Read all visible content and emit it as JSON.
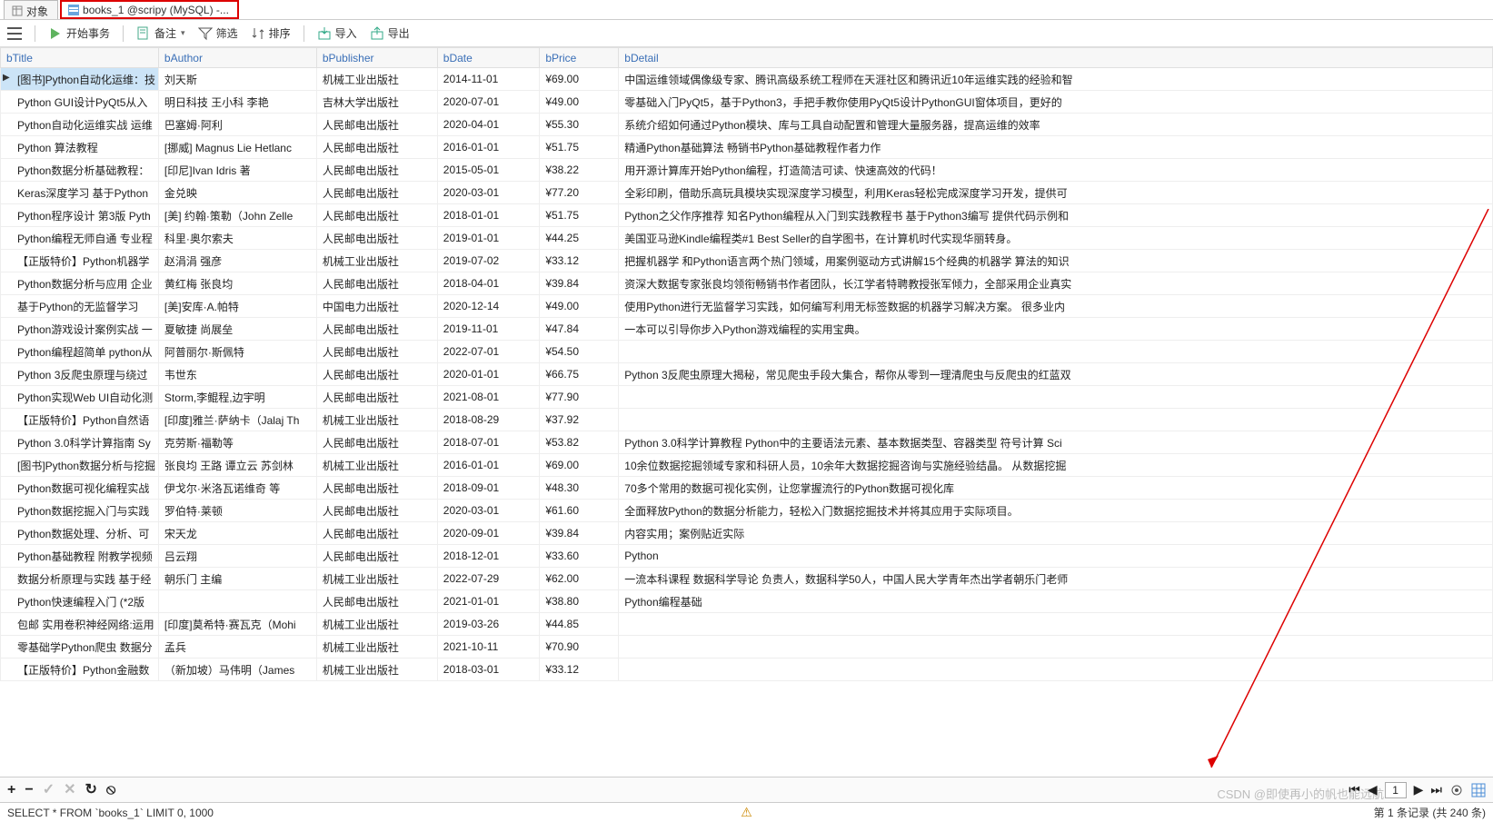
{
  "tabs": {
    "objects": "对象",
    "active": "books_1 @scripy (MySQL) -..."
  },
  "toolbar": {
    "begin_tx": "开始事务",
    "memo": "备注",
    "filter": "筛选",
    "sort": "排序",
    "import": "导入",
    "export": "导出"
  },
  "columns": {
    "bTitle": "bTitle",
    "bAuthor": "bAuthor",
    "bPublisher": "bPublisher",
    "bDate": "bDate",
    "bPrice": "bPrice",
    "bDetail": "bDetail"
  },
  "rows": [
    {
      "bTitle": "[图书]Python自动化运维：技",
      "bAuthor": "刘天斯",
      "bPublisher": "机械工业出版社",
      "bDate": "2014-11-01",
      "bPrice": "¥69.00",
      "bDetail": "中国运维领域偶像级专家、腾讯高级系统工程师在天涯社区和腾讯近10年运维实践的经验和智"
    },
    {
      "bTitle": "Python GUI设计PyQt5从入",
      "bAuthor": "明日科技 王小科 李艳",
      "bPublisher": "吉林大学出版社",
      "bDate": "2020-07-01",
      "bPrice": "¥49.00",
      "bDetail": "零基础入门PyQt5，基于Python3，手把手教你使用PyQt5设计PythonGUI窗体项目，更好的"
    },
    {
      "bTitle": "Python自动化运维实战 运维",
      "bAuthor": "巴塞姆·阿利",
      "bPublisher": "人民邮电出版社",
      "bDate": "2020-04-01",
      "bPrice": "¥55.30",
      "bDetail": "系统介绍如何通过Python模块、库与工具自动配置和管理大量服务器，提高运维的效率"
    },
    {
      "bTitle": "Python 算法教程",
      "bAuthor": "[挪威] Magnus Lie Hetlanc",
      "bPublisher": "人民邮电出版社",
      "bDate": "2016-01-01",
      "bPrice": "¥51.75",
      "bDetail": "精通Python基础算法 畅销书Python基础教程作者力作"
    },
    {
      "bTitle": "Python数据分析基础教程：",
      "bAuthor": "[印尼]Ivan Idris 著",
      "bPublisher": "人民邮电出版社",
      "bDate": "2015-05-01",
      "bPrice": "¥38.22",
      "bDetail": "用开源计算库开始Python编程，打造简洁可读、快速高效的代码！"
    },
    {
      "bTitle": "Keras深度学习 基于Python",
      "bAuthor": "金兑映",
      "bPublisher": "人民邮电出版社",
      "bDate": "2020-03-01",
      "bPrice": "¥77.20",
      "bDetail": "全彩印刷，借助乐高玩具模块实现深度学习模型，利用Keras轻松完成深度学习开发，提供可"
    },
    {
      "bTitle": "Python程序设计 第3版 Pyth",
      "bAuthor": "[美] 约翰·策勒（John Zelle",
      "bPublisher": "人民邮电出版社",
      "bDate": "2018-01-01",
      "bPrice": "¥51.75",
      "bDetail": "Python之父作序推荐 知名Python编程从入门到实践教程书 基于Python3编写 提供代码示例和"
    },
    {
      "bTitle": "Python编程无师自通 专业程",
      "bAuthor": "科里·奥尔索夫",
      "bPublisher": "人民邮电出版社",
      "bDate": "2019-01-01",
      "bPrice": "¥44.25",
      "bDetail": "美国亚马逊Kindle编程类#1 Best Seller的自学图书，在计算机时代实现华丽转身。"
    },
    {
      "bTitle": "【正版特价】Python机器学",
      "bAuthor": "赵涓涓 强彦",
      "bPublisher": "机械工业出版社",
      "bDate": "2019-07-02",
      "bPrice": "¥33.12",
      "bDetail": "把握机器学 和Python语言两个热门领域，用案例驱动方式讲解15个经典的机器学 算法的知识"
    },
    {
      "bTitle": "Python数据分析与应用 企业",
      "bAuthor": "黄红梅 张良均",
      "bPublisher": "人民邮电出版社",
      "bDate": "2018-04-01",
      "bPrice": "¥39.84",
      "bDetail": "资深大数据专家张良均领衔畅销书作者团队，长江学者特聘教授张军倾力，全部采用企业真实"
    },
    {
      "bTitle": "基于Python的无监督学习",
      "bAuthor": "[美]安库·A.帕特",
      "bPublisher": "中国电力出版社",
      "bDate": "2020-12-14",
      "bPrice": "¥49.00",
      "bDetail": "使用Python进行无监督学习实践，如何编写利用无标签数据的机器学习解决方案。 很多业内"
    },
    {
      "bTitle": "Python游戏设计案例实战 一",
      "bAuthor": "夏敏捷 尚展垒",
      "bPublisher": "人民邮电出版社",
      "bDate": "2019-11-01",
      "bPrice": "¥47.84",
      "bDetail": "一本可以引导你步入Python游戏编程的实用宝典。"
    },
    {
      "bTitle": "Python编程超简单 python从",
      "bAuthor": "阿普丽尔·斯佩特",
      "bPublisher": "人民邮电出版社",
      "bDate": "2022-07-01",
      "bPrice": "¥54.50",
      "bDetail": ""
    },
    {
      "bTitle": "Python 3反爬虫原理与绕过",
      "bAuthor": "韦世东",
      "bPublisher": "人民邮电出版社",
      "bDate": "2020-01-01",
      "bPrice": "¥66.75",
      "bDetail": "Python 3反爬虫原理大揭秘，常见爬虫手段大集合，帮你从零到一理清爬虫与反爬虫的红蓝双"
    },
    {
      "bTitle": "Python实现Web UI自动化测",
      "bAuthor": "Storm,李鲲程,边宇明",
      "bPublisher": "人民邮电出版社",
      "bDate": "2021-08-01",
      "bPrice": "¥77.90",
      "bDetail": ""
    },
    {
      "bTitle": "【正版特价】Python自然语",
      "bAuthor": "[印度]雅兰·萨纳卡（Jalaj Th",
      "bPublisher": "机械工业出版社",
      "bDate": "2018-08-29",
      "bPrice": "¥37.92",
      "bDetail": ""
    },
    {
      "bTitle": "Python 3.0科学计算指南 Sy",
      "bAuthor": "克劳斯·福勒等",
      "bPublisher": "人民邮电出版社",
      "bDate": "2018-07-01",
      "bPrice": "¥53.82",
      "bDetail": "Python 3.0科学计算教程 Python中的主要语法元素、基本数据类型、容器类型 符号计算 Sci"
    },
    {
      "bTitle": "[图书]Python数据分析与挖掘",
      "bAuthor": "张良均 王路 谭立云 苏剑林",
      "bPublisher": "机械工业出版社",
      "bDate": "2016-01-01",
      "bPrice": "¥69.00",
      "bDetail": "10余位数据挖掘领域专家和科研人员，10余年大数据挖掘咨询与实施经验结晶。 从数据挖掘"
    },
    {
      "bTitle": "Python数据可视化编程实战",
      "bAuthor": "伊戈尔·米洛瓦诺维奇 等",
      "bPublisher": "人民邮电出版社",
      "bDate": "2018-09-01",
      "bPrice": "¥48.30",
      "bDetail": "70多个常用的数据可视化实例，让您掌握流行的Python数据可视化库"
    },
    {
      "bTitle": "Python数据挖掘入门与实践",
      "bAuthor": "罗伯特·莱顿",
      "bPublisher": "人民邮电出版社",
      "bDate": "2020-03-01",
      "bPrice": "¥61.60",
      "bDetail": "全面释放Python的数据分析能力，轻松入门数据挖掘技术并将其应用于实际项目。"
    },
    {
      "bTitle": "Python数据处理、分析、可",
      "bAuthor": "宋天龙",
      "bPublisher": "人民邮电出版社",
      "bDate": "2020-09-01",
      "bPrice": "¥39.84",
      "bDetail": "内容实用；案例贴近实际"
    },
    {
      "bTitle": "Python基础教程 附教学视频",
      "bAuthor": "吕云翔",
      "bPublisher": "人民邮电出版社",
      "bDate": "2018-12-01",
      "bPrice": "¥33.60",
      "bDetail": "Python"
    },
    {
      "bTitle": "数据分析原理与实践 基于经",
      "bAuthor": "朝乐门 主编",
      "bPublisher": "机械工业出版社",
      "bDate": "2022-07-29",
      "bPrice": "¥62.00",
      "bDetail": "一流本科课程 数据科学导论 负责人，数据科学50人，中国人民大学青年杰出学者朝乐门老师"
    },
    {
      "bTitle": "Python快速编程入门 (*2版",
      "bAuthor": "",
      "bPublisher": "人民邮电出版社",
      "bDate": "2021-01-01",
      "bPrice": "¥38.80",
      "bDetail": "Python编程基础"
    },
    {
      "bTitle": "包邮 实用卷积神经网络:运用",
      "bAuthor": "[印度]莫希特·赛瓦克（Mohi",
      "bPublisher": "机械工业出版社",
      "bDate": "2019-03-26",
      "bPrice": "¥44.85",
      "bDetail": ""
    },
    {
      "bTitle": "零基础学Python爬虫 数据分",
      "bAuthor": "孟兵",
      "bPublisher": "机械工业出版社",
      "bDate": "2021-10-11",
      "bPrice": "¥70.90",
      "bDetail": ""
    },
    {
      "bTitle": "【正版特价】Python金融数",
      "bAuthor": "（新加坡）马伟明（James",
      "bPublisher": "机械工业出版社",
      "bDate": "2018-03-01",
      "bPrice": "¥33.12",
      "bDetail": ""
    }
  ],
  "footer": {
    "page": "1",
    "record_info": "第 1 条记录 (共 240 条)"
  },
  "status": {
    "query": "SELECT * FROM `books_1` LIMIT 0, 1000"
  },
  "watermark": "CSDN @即使再小的帆也能远航"
}
